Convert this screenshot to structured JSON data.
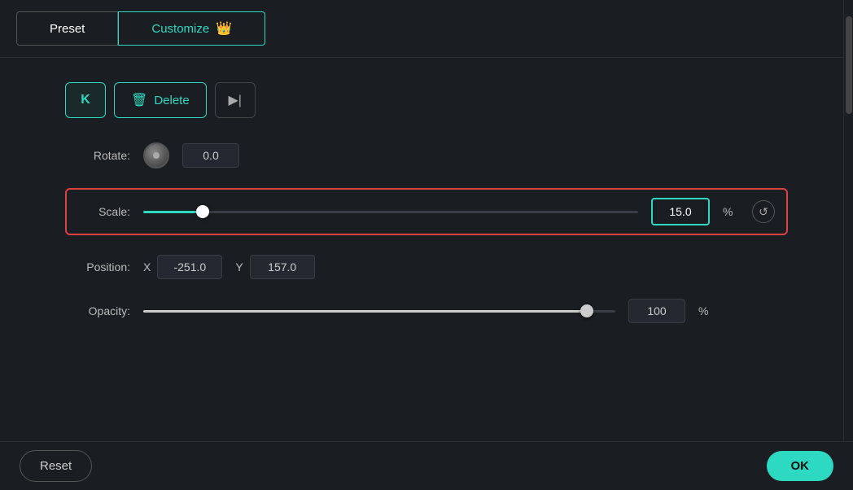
{
  "header": {
    "preset_tab": "Preset",
    "customize_tab": "Customize",
    "crown_emoji": "👑"
  },
  "toolbar": {
    "k_button": "K",
    "delete_button": "Delete",
    "skip_icon": "▶|"
  },
  "controls": {
    "rotate_label": "Rotate:",
    "rotate_value": "0.0",
    "scale_label": "Scale:",
    "scale_value": "15.0",
    "scale_unit": "%",
    "position_label": "Position:",
    "position_x_label": "X",
    "position_x_value": "-251.0",
    "position_y_label": "Y",
    "position_y_value": "157.0",
    "opacity_label": "Opacity:",
    "opacity_value": "100",
    "opacity_unit": "%"
  },
  "bottom": {
    "reset_label": "Reset",
    "ok_label": "OK"
  }
}
